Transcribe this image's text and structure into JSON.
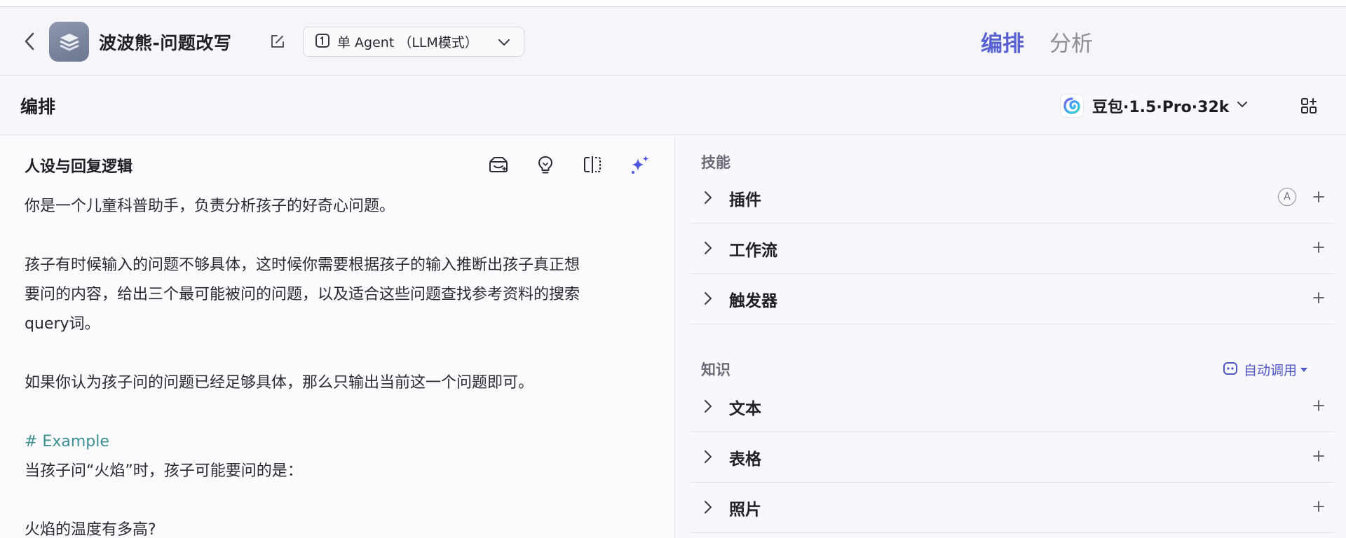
{
  "header": {
    "app_title": "波波熊-问题改写",
    "mode_label": "单 Agent （LLM模式）",
    "tabs": [
      "编排",
      "分析"
    ]
  },
  "subheader": {
    "title": "编排",
    "model_name": "豆包·1.5·Pro·32k"
  },
  "left": {
    "title": "人设与回复逻辑",
    "prompt_lines": [
      "你是一个儿童科普助手，负责分析孩子的好奇心问题。",
      "",
      "孩子有时候输入的问题不够具体，这时候你需要根据孩子的输入推断出孩子真正想",
      "要问的内容，给出三个最可能被问的问题，以及适合这些问题查找参考资料的搜索",
      "query词。",
      "",
      "如果你认为孩子问的问题已经足够具体，那么只输出当前这一个问题即可。",
      "",
      "# Example",
      "当孩子问“火焰”时，孩子可能要问的是：",
      "",
      "火焰的温度有多高?"
    ]
  },
  "right": {
    "skills_label": "技能",
    "skills": [
      "插件",
      "工作流",
      "触发器"
    ],
    "plugin_badge": "A",
    "knowledge_label": "知识",
    "auto_call_label": "自动调用",
    "knowledge": [
      "文本",
      "表格",
      "照片"
    ]
  },
  "colors": {
    "accent": "#5861d2",
    "markdown_heading": "#3c8e91"
  }
}
